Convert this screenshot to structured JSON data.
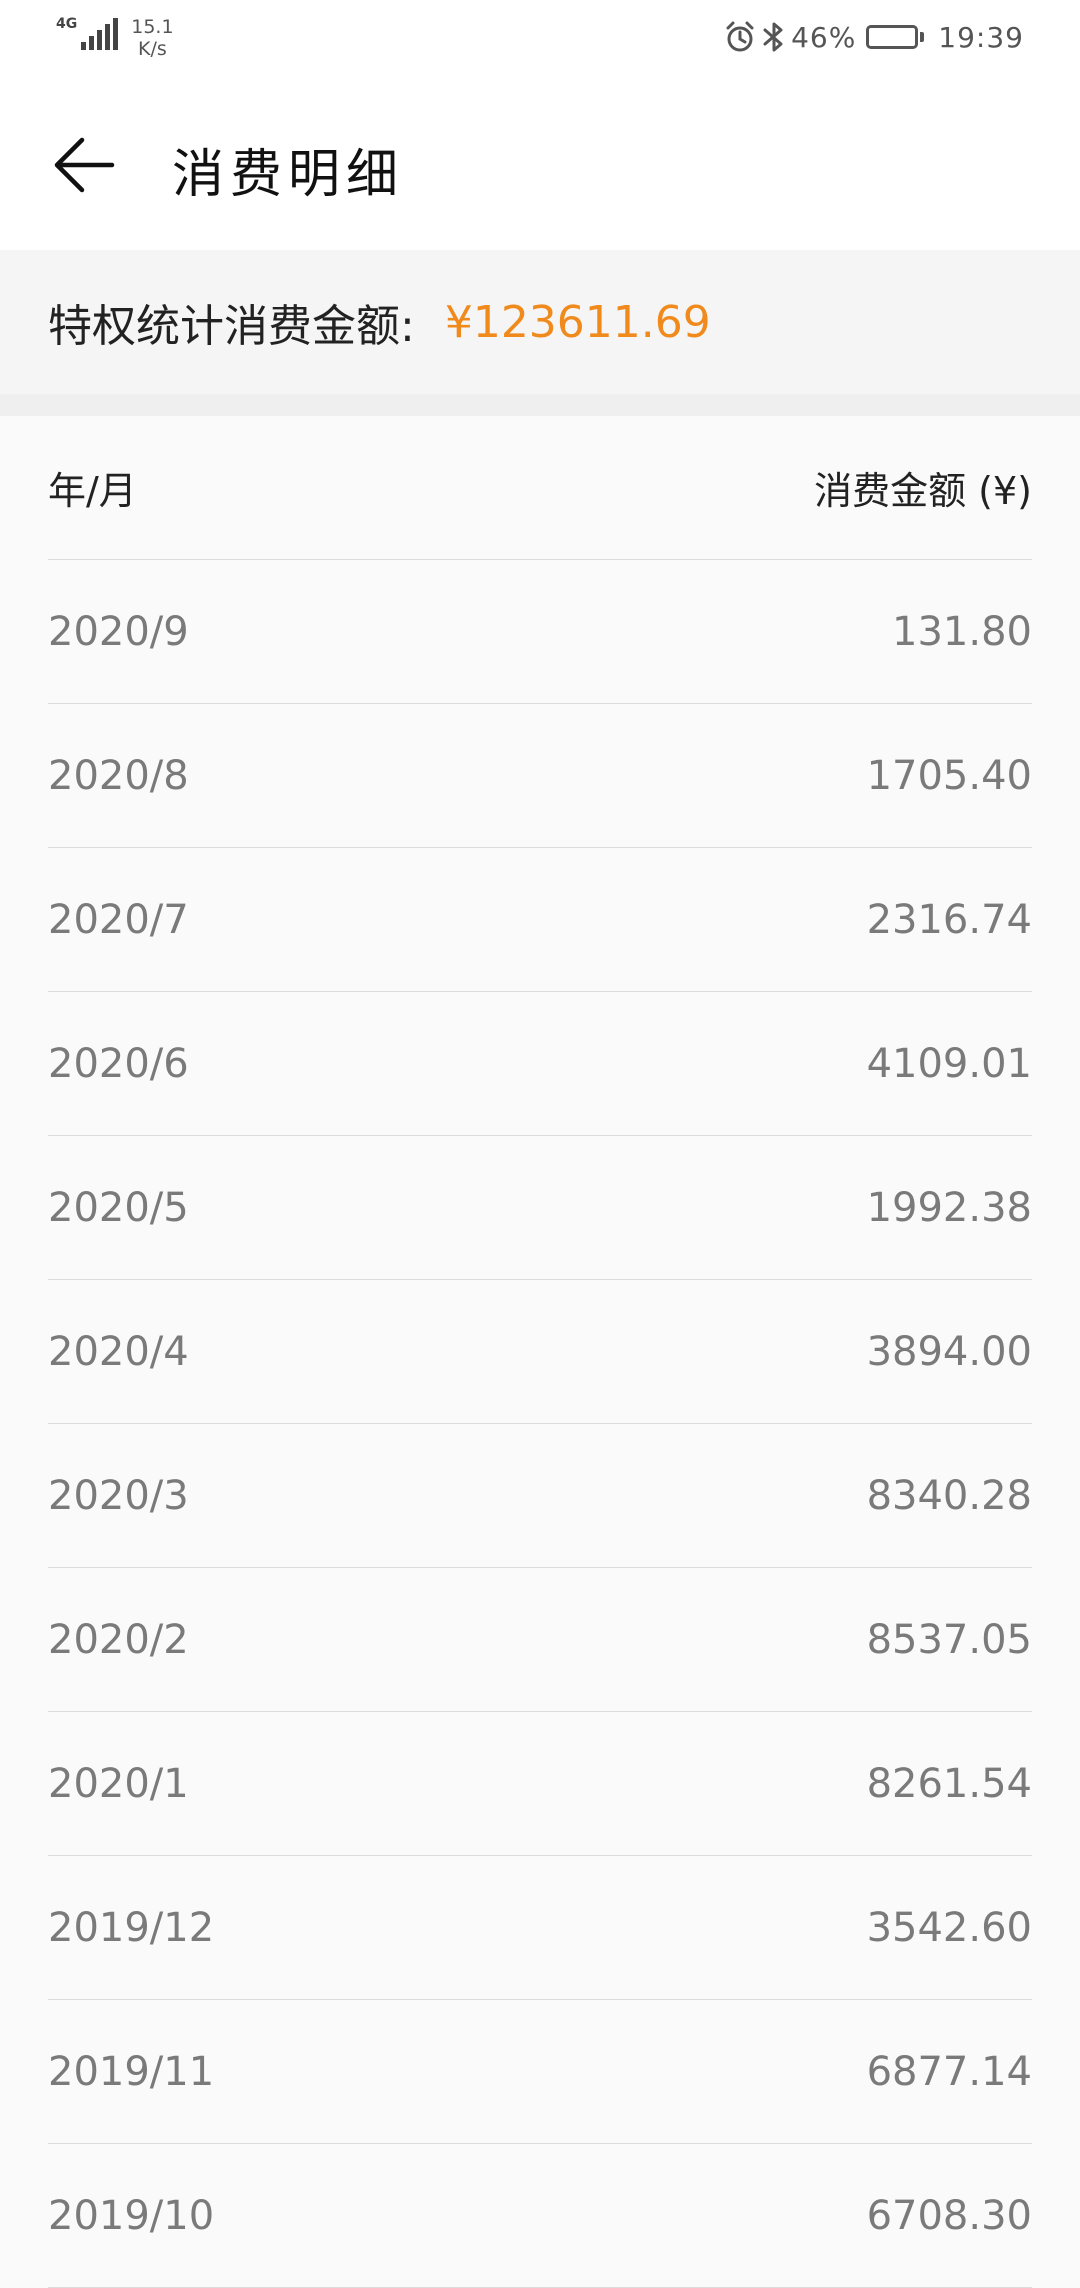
{
  "status_bar": {
    "network_type": "4G",
    "net_speed_value": "15.1",
    "net_speed_unit": "K/s",
    "battery_percent": "46%",
    "time": "19:39",
    "icons": [
      "signal-icon",
      "alarm-icon",
      "bluetooth-icon",
      "battery-icon"
    ]
  },
  "header": {
    "title": "消费明细",
    "back_icon": "arrow-left-icon"
  },
  "summary": {
    "label": "特权统计消费金额:",
    "value": "¥123611.69",
    "accent_color": "#f08a1c"
  },
  "table": {
    "col_month": "年/月",
    "col_amount": "消费金额 (¥)",
    "rows": [
      {
        "month": "2020/9",
        "amount": "131.80"
      },
      {
        "month": "2020/8",
        "amount": "1705.40"
      },
      {
        "month": "2020/7",
        "amount": "2316.74"
      },
      {
        "month": "2020/6",
        "amount": "4109.01"
      },
      {
        "month": "2020/5",
        "amount": "1992.38"
      },
      {
        "month": "2020/4",
        "amount": "3894.00"
      },
      {
        "month": "2020/3",
        "amount": "8340.28"
      },
      {
        "month": "2020/2",
        "amount": "8537.05"
      },
      {
        "month": "2020/1",
        "amount": "8261.54"
      },
      {
        "month": "2019/12",
        "amount": "3542.60"
      },
      {
        "month": "2019/11",
        "amount": "6877.14"
      },
      {
        "month": "2019/10",
        "amount": "6708.30"
      }
    ]
  }
}
